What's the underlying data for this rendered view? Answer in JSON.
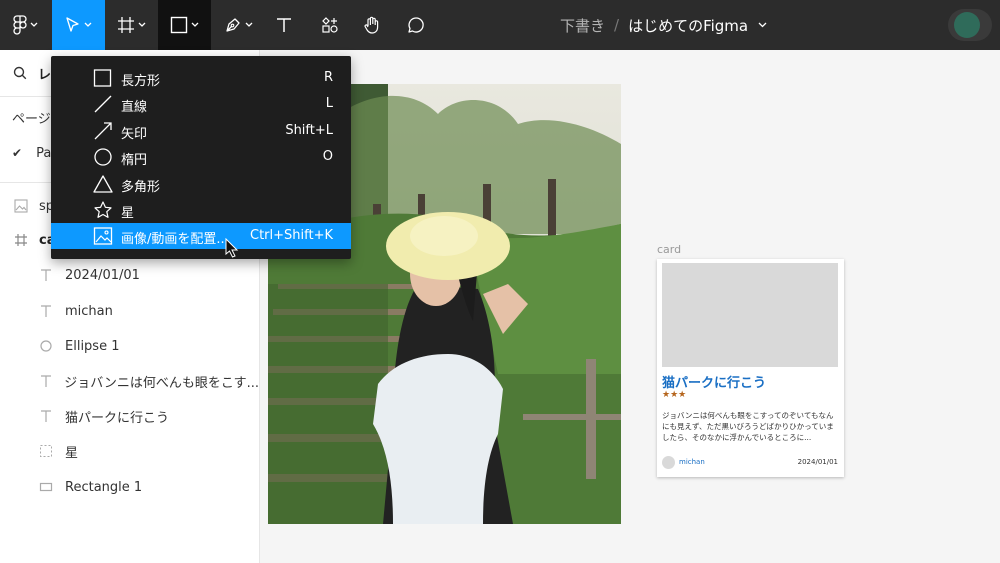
{
  "toolbar": {
    "tools": [
      "main-menu",
      "move",
      "frame",
      "shape",
      "pen",
      "text",
      "resources",
      "hand",
      "comment"
    ],
    "accent_color": "#0d99ff"
  },
  "title": {
    "draft": "下書き",
    "separator": "/",
    "file_name": "はじめてのFigma"
  },
  "left_panel": {
    "search_partial": "レ",
    "pages_partial": "ページ",
    "page_partial": "Pa",
    "layers": [
      {
        "icon": "image-icon",
        "label": "sp"
      },
      {
        "icon": "frame-icon",
        "label": "ca"
      },
      {
        "icon": "text-icon",
        "label": "2024/01/01"
      },
      {
        "icon": "text-icon",
        "label": "michan"
      },
      {
        "icon": "ellipse-icon",
        "label": "Ellipse 1"
      },
      {
        "icon": "text-icon",
        "label": "ジョバンニは何べんも眼をこす..."
      },
      {
        "icon": "text-icon",
        "label": "猫パークに行こう"
      },
      {
        "icon": "star-icon",
        "label": "星"
      },
      {
        "icon": "rectangle-icon",
        "label": "Rectangle 1"
      }
    ]
  },
  "shape_menu": {
    "items": [
      {
        "icon": "rectangle-icon",
        "label": "長方形",
        "shortcut": "R"
      },
      {
        "icon": "line-icon",
        "label": "直線",
        "shortcut": "L"
      },
      {
        "icon": "arrow-icon",
        "label": "矢印",
        "shortcut": "Shift+L"
      },
      {
        "icon": "ellipse-icon",
        "label": "楕円",
        "shortcut": "O"
      },
      {
        "icon": "polygon-icon",
        "label": "多角形",
        "shortcut": ""
      },
      {
        "icon": "star-icon",
        "label": "星",
        "shortcut": ""
      },
      {
        "icon": "image-icon",
        "label": "画像/動画を配置...",
        "shortcut": "Ctrl+Shift+K",
        "highlighted": true
      }
    ]
  },
  "canvas": {
    "frame_label": "card",
    "card": {
      "title": "猫パークに行こう",
      "stars": "★★★",
      "body": "ジョバンニは何べんも眼をこすってのぞいてもなんにも見えず、ただ黒いびろうどばかりひかっていましたら、そのなかに浮かんでいるところに...",
      "author": "michan",
      "date": "2024/01/01"
    }
  }
}
